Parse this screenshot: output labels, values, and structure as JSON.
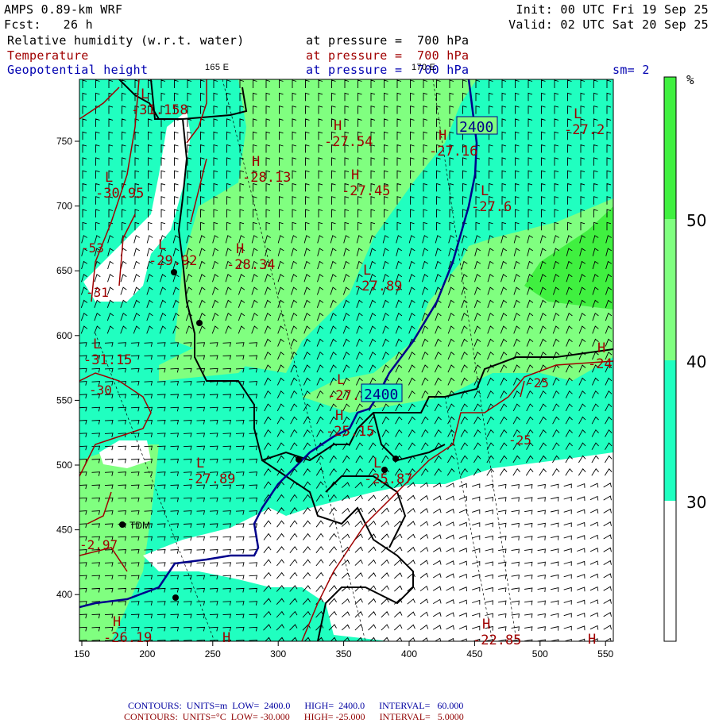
{
  "header": {
    "model": "AMPS 0.89-km WRF",
    "forecast": "Fcst:   26 h",
    "init": "Init: 00 UTC Fri 19 Sep 25",
    "valid": "Valid: 02 UTC Sat 20 Sep 25",
    "fields": [
      {
        "name": "Relative humidity (w.r.t. water)",
        "level": "at pressure =  700 hPa",
        "color": "#000000"
      },
      {
        "name": "Temperature",
        "level": "at pressure =  700 hPa",
        "color": "#a00000"
      },
      {
        "name": "Geopotential height",
        "level": "at pressure =  700 hPa",
        "color": "#0000b0"
      }
    ],
    "smoothing": "sm= 2",
    "lon_labels": [
      "165 E",
      "170 E"
    ]
  },
  "axes": {
    "x_ticks": [
      "150",
      "200",
      "250",
      "300",
      "350",
      "400",
      "450",
      "500",
      "550"
    ],
    "y_ticks": [
      "750",
      "700",
      "650",
      "600",
      "550",
      "500",
      "450",
      "400"
    ]
  },
  "colorbar": {
    "unit": "%",
    "ticks": [
      "50",
      "40",
      "30"
    ],
    "colors": {
      "above50": "#40f040",
      "40to50": "#80ff80",
      "30to40": "#20ffc0",
      "below30": "#ffffff"
    }
  },
  "height_labels": [
    "2400",
    "2400"
  ],
  "temp_labels": [
    {
      "kind": "L",
      "value": "-31.158"
    },
    {
      "kind": "L",
      "value": "-30.95"
    },
    {
      "kind": "L",
      "value": "-29.92"
    },
    {
      "kind": "H",
      "value": "-28.13"
    },
    {
      "kind": "H",
      "value": "-28.34"
    },
    {
      "kind": "H",
      "value": "-27.54"
    },
    {
      "kind": "H",
      "value": "-27.45"
    },
    {
      "kind": "H",
      "value": "-27.16"
    },
    {
      "kind": "L",
      "value": "-27.6"
    },
    {
      "kind": "L",
      "value": "-27.2"
    },
    {
      "kind": "L",
      "value": "-27.89"
    },
    {
      "kind": "L",
      "value": "-27.47"
    },
    {
      "kind": "H",
      "value": "-25.15"
    },
    {
      "kind": "L",
      "value": "-27.89"
    },
    {
      "kind": "L",
      "value": "-25.87"
    },
    {
      "kind": "H",
      "value": "-24"
    },
    {
      "kind": "L",
      "value": "-31.15"
    },
    {
      "kind": "H",
      "value": "-26.19"
    },
    {
      "kind": "H",
      "value": "-22.85"
    },
    {
      "kind": "H",
      "value": ""
    },
    {
      "kind": "H",
      "value": ""
    }
  ],
  "contour_values": [
    "-25",
    "-30",
    "-25",
    "-53",
    "-31",
    "-2.97"
  ],
  "stations": [
    {
      "name": "TDM"
    }
  ],
  "footer": {
    "height_contours": {
      "label": "CONTOURS:",
      "units": "UNITS=m",
      "low": "LOW=  2400.0",
      "high": "HIGH=  2400.0",
      "interval": "INTERVAL=   60.000"
    },
    "temp_contours": {
      "label": "CONTOURS:",
      "units": "UNITS=°C",
      "low": "LOW= -30.000",
      "high": "HIGH= -25.000",
      "interval": "INTERVAL=   5.0000"
    }
  }
}
